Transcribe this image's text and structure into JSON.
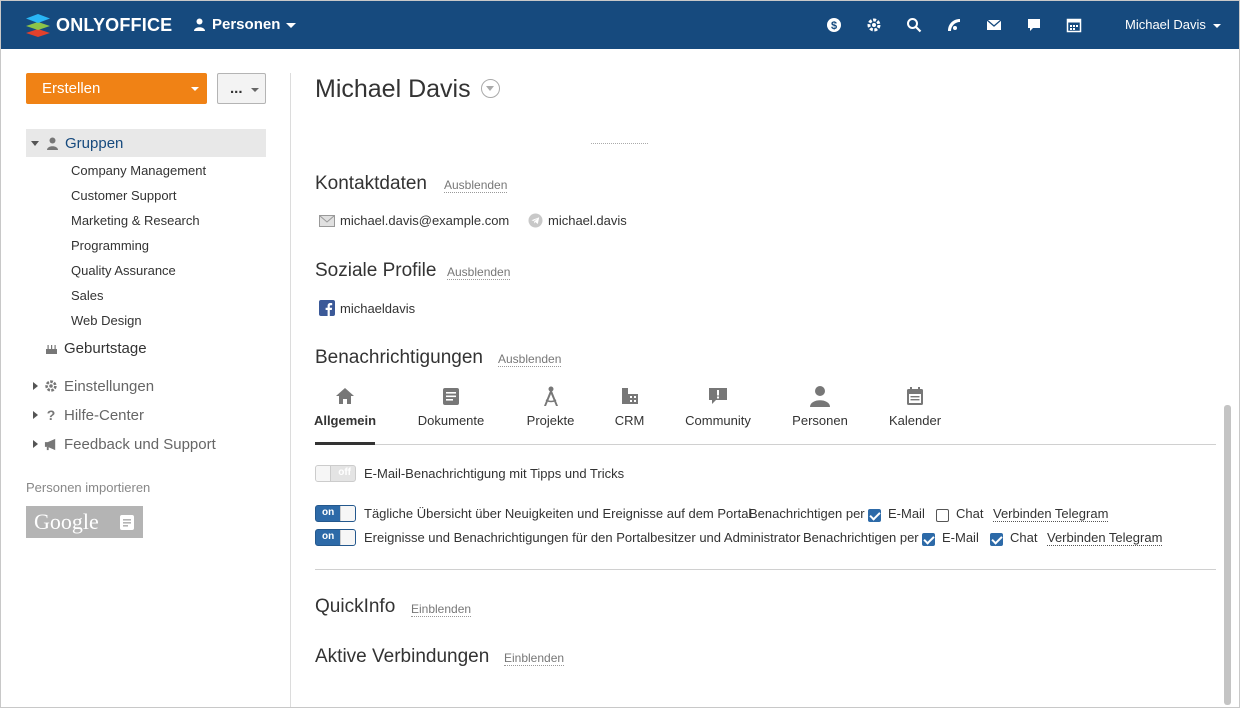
{
  "header": {
    "logo_text": "ONLYOFFICE",
    "module_label": "Personen",
    "user_name": "Michael Davis",
    "icons": [
      "payments-icon",
      "settings-icon",
      "search-icon",
      "feed-icon",
      "mail-icon",
      "chat-icon",
      "calendar-icon"
    ]
  },
  "sidebar": {
    "create_label": "Erstellen",
    "more_label": "...",
    "groups_label": "Gruppen",
    "groups": [
      "Company Management",
      "Customer Support",
      "Marketing & Research",
      "Programming",
      "Quality Assurance",
      "Sales",
      "Web Design"
    ],
    "birthdays_label": "Geburtstage",
    "settings_label": "Einstellungen",
    "help_label": "Hilfe-Center",
    "feedback_label": "Feedback und Support",
    "import_label": "Personen importieren",
    "google_label": "Google"
  },
  "profile": {
    "name": "Michael Davis",
    "contacts": {
      "title": "Kontaktdaten",
      "toggle": "Ausblenden",
      "email": "michael.davis@example.com",
      "telegram": "michael.davis"
    },
    "social": {
      "title": "Soziale Profile",
      "toggle": "Ausblenden",
      "facebook": "michaeldavis"
    },
    "notifications": {
      "title": "Benachrichtigungen",
      "toggle": "Ausblenden",
      "tabs": [
        "Allgemein",
        "Dokumente",
        "Projekte",
        "CRM",
        "Community",
        "Personen",
        "Kalender"
      ],
      "active_tab": "Allgemein",
      "rows": [
        {
          "state": "off",
          "text": "E-Mail-Benachrichtigung mit Tipps und Tricks"
        },
        {
          "state": "on",
          "text": "Tägliche Übersicht über Neuigkeiten und Ereignisse auf dem Portal",
          "notify_label": "Benachrichtigen per",
          "email_label": "E-Mail",
          "email_checked": true,
          "chat_label": "Chat",
          "chat_checked": false,
          "telegram_label": "Verbinden Telegram"
        },
        {
          "state": "on",
          "text": "Ereignisse und Benachrichtigungen für den Portalbesitzer und Administrator",
          "notify_label": "Benachrichtigen per",
          "email_label": "E-Mail",
          "email_checked": true,
          "chat_label": "Chat",
          "chat_checked": true,
          "telegram_label": "Verbinden Telegram"
        }
      ]
    },
    "quickinfo": {
      "title": "QuickInfo",
      "toggle": "Einblenden"
    },
    "connections": {
      "title": "Aktive Verbindungen",
      "toggle": "Einblenden"
    }
  },
  "colors": {
    "header_bg": "#164a7e",
    "create_btn": "#f08215",
    "accent_blue": "#2d6aa8"
  }
}
